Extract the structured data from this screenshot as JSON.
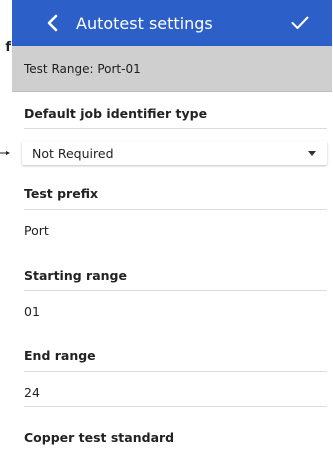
{
  "background": {
    "fragment_text": "f"
  },
  "app_bar": {
    "title": "Autotest settings",
    "back_icon": "chevron-left-icon",
    "confirm_icon": "check-icon",
    "color": "#2c5fc8"
  },
  "subheader": {
    "text": "Test Range: Port-01",
    "color": "#cfcfcf"
  },
  "fields": {
    "job_identifier": {
      "label": "Default job identifier type",
      "value": "Not Required",
      "caret_icon": "caret-down-icon"
    },
    "test_prefix": {
      "label": "Test prefix",
      "value": "Port"
    },
    "starting_range": {
      "label": "Starting range",
      "value": "01"
    },
    "end_range": {
      "label": "End range",
      "value": "24"
    },
    "copper_standard": {
      "label": "Copper test standard"
    }
  }
}
